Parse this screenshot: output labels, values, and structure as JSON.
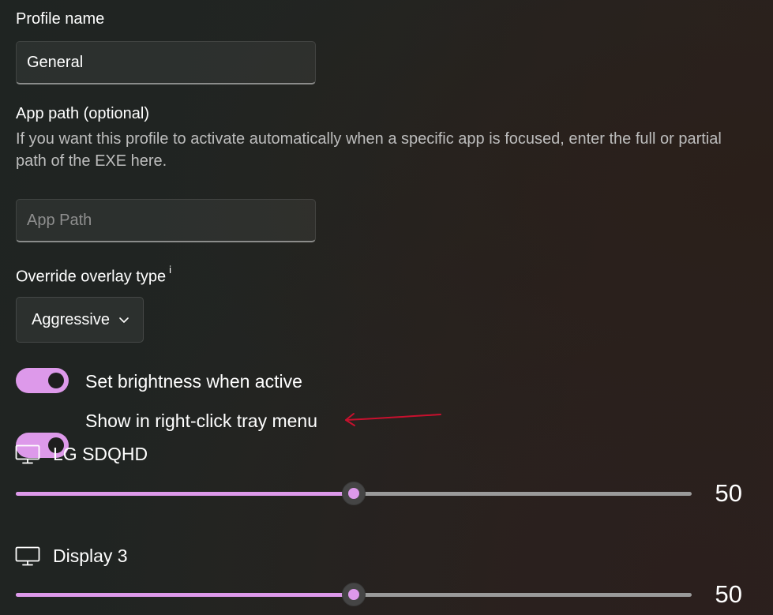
{
  "profile_name": {
    "label": "Profile name",
    "value": "General"
  },
  "app_path": {
    "label": "App path (optional)",
    "description": "If you want this profile to activate automatically when a specific app is focused, enter the full or partial path of the EXE here.",
    "value": "",
    "placeholder": "App Path"
  },
  "overlay": {
    "label": "Override overlay type",
    "info_marker": "i",
    "selected": "Aggressive"
  },
  "toggles": [
    {
      "label": "Set brightness when active",
      "on": true
    },
    {
      "label": "Show in right-click tray menu",
      "on": true
    }
  ],
  "displays": [
    {
      "name": "LG SDQHD",
      "brightness": 50,
      "value_text": "50",
      "icon": "monitor-icon"
    },
    {
      "name": "Display 3",
      "brightness": 50,
      "value_text": "50",
      "icon": "monitor-icon"
    }
  ],
  "colors": {
    "accent": "#dd99ea",
    "annotation_arrow": "#c8102e"
  },
  "slider_range": [
    0,
    100
  ]
}
